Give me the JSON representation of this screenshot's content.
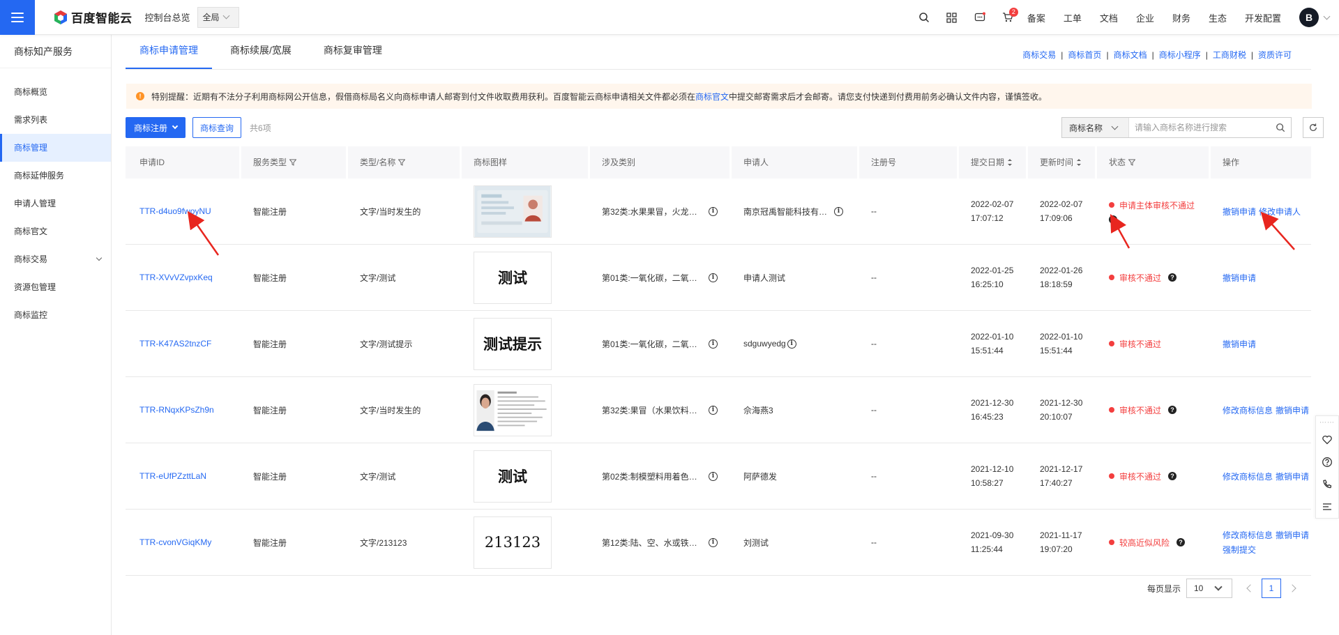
{
  "topbar": {
    "logo_text": "百度智能云",
    "console_link": "控制台总览",
    "region": "全局",
    "cart_badge": "2",
    "menu": [
      "备案",
      "工单",
      "文档",
      "企业",
      "财务",
      "生态",
      "开发配置"
    ],
    "avatar_letter": "B"
  },
  "sidebar": {
    "title": "商标知产服务",
    "items": [
      "商标概览",
      "需求列表",
      "商标管理",
      "商标延伸服务",
      "申请人管理",
      "商标官文",
      "商标交易",
      "资源包管理",
      "商标监控"
    ],
    "active_index": 2
  },
  "tabs": [
    "商标申请管理",
    "商标续展/宽展",
    "商标复审管理"
  ],
  "quick_links": [
    "商标交易",
    "商标首页",
    "商标文档",
    "商标小程序",
    "工商财税",
    "资质许可"
  ],
  "notice": {
    "pre": "特别提醒：近期有不法分子利用商标网公开信息，假借商标局名义向商标申请人邮寄到付文件收取费用获利。百度智能云商标申请相关文件都必须在",
    "link": "商标官文",
    "post": "中提交邮寄需求后才会邮寄。请您支付快递到付费用前务必确认文件内容，谨慎签收。"
  },
  "toolbar": {
    "register_btn": "商标注册",
    "query_btn": "商标查询",
    "total": "共6项"
  },
  "search": {
    "field": "商标名称",
    "placeholder": "请输入商标名称进行搜索"
  },
  "table": {
    "headers": [
      "申请ID",
      "服务类型",
      "类型/名称",
      "商标图样",
      "涉及类别",
      "申请人",
      "注册号",
      "提交日期",
      "更新时间",
      "状态",
      "操作"
    ],
    "rows": [
      {
        "id": "TTR-d4uo9fwoyNU",
        "service": "智能注册",
        "type_name": "文字/当时发生的",
        "image": "",
        "category": "第32类:水果果冒，火龙果汁…",
        "applicant": "南京冠禹智能科技有限公司",
        "applicant_info": true,
        "reg_no": "--",
        "submit_date": "2022-02-07",
        "submit_time": "17:07:12",
        "update_date": "2022-02-07",
        "update_time": "17:09:06",
        "status": "申请主体审核不通过",
        "ops": [
          "撤销申请",
          "修改申请人"
        ]
      },
      {
        "id": "TTR-XVvVZvpxKeq",
        "service": "智能注册",
        "type_name": "文字/测试",
        "image": "测试",
        "category": "第01类:一氧化碳，二氧化碳…",
        "applicant": "申请人测试",
        "applicant_info": false,
        "reg_no": "--",
        "submit_date": "2022-01-25",
        "submit_time": "16:25:10",
        "update_date": "2022-01-26",
        "update_time": "18:18:59",
        "status": "审核不通过",
        "ops": [
          "撤销申请"
        ]
      },
      {
        "id": "TTR-K47AS2tnzCF",
        "service": "智能注册",
        "type_name": "文字/测试提示",
        "image": "测试提示",
        "category": "第01类:一氧化碳，二氧化碳…",
        "applicant": "sdguwyedg",
        "applicant_info": true,
        "reg_no": "--",
        "submit_date": "2022-01-10",
        "submit_time": "15:51:44",
        "update_date": "2022-01-10",
        "update_time": "15:51:44",
        "status": "审核不通过",
        "ops": [
          "撤销申请"
        ]
      },
      {
        "id": "TTR-RNqxKPsZh9n",
        "service": "智能注册",
        "type_name": "文字/当时发生的",
        "image": "",
        "category": "第32类:果冒（水果饮料，…",
        "applicant": "佘海燕3",
        "applicant_info": false,
        "reg_no": "--",
        "submit_date": "2021-12-30",
        "submit_time": "16:45:23",
        "update_date": "2021-12-30",
        "update_time": "20:10:07",
        "status": "审核不通过",
        "ops": [
          "修改商标信息",
          "撤销申请"
        ]
      },
      {
        "id": "TTR-eUfPZzttLaN",
        "service": "智能注册",
        "type_name": "文字/测试",
        "image": "测试",
        "category": "第02类:制模塑料用着色剂…",
        "applicant": "阿萨德发",
        "applicant_info": false,
        "reg_no": "--",
        "submit_date": "2021-12-10",
        "submit_time": "10:58:27",
        "update_date": "2021-12-17",
        "update_time": "17:40:27",
        "status": "审核不通过",
        "ops": [
          "修改商标信息",
          "撤销申请"
        ]
      },
      {
        "id": "TTR-cvonVGiqKMy",
        "service": "智能注册",
        "type_name": "文字/213123",
        "image": "213123",
        "category": "第12类:陆、空、水或铁路…",
        "applicant": "刘测试",
        "applicant_info": false,
        "reg_no": "--",
        "submit_date": "2021-09-30",
        "submit_time": "11:25:44",
        "update_date": "2021-11-17",
        "update_time": "19:07:20",
        "status": "较高近似风险",
        "ops": [
          "修改商标信息",
          "撤销申请",
          "强制提交"
        ]
      }
    ]
  },
  "pagination": {
    "label": "每页显示",
    "page_size": "10",
    "current_page": "1"
  },
  "colors": {
    "primary": "#2468f2",
    "danger": "#f33e3e",
    "warning": "#ff9326"
  }
}
